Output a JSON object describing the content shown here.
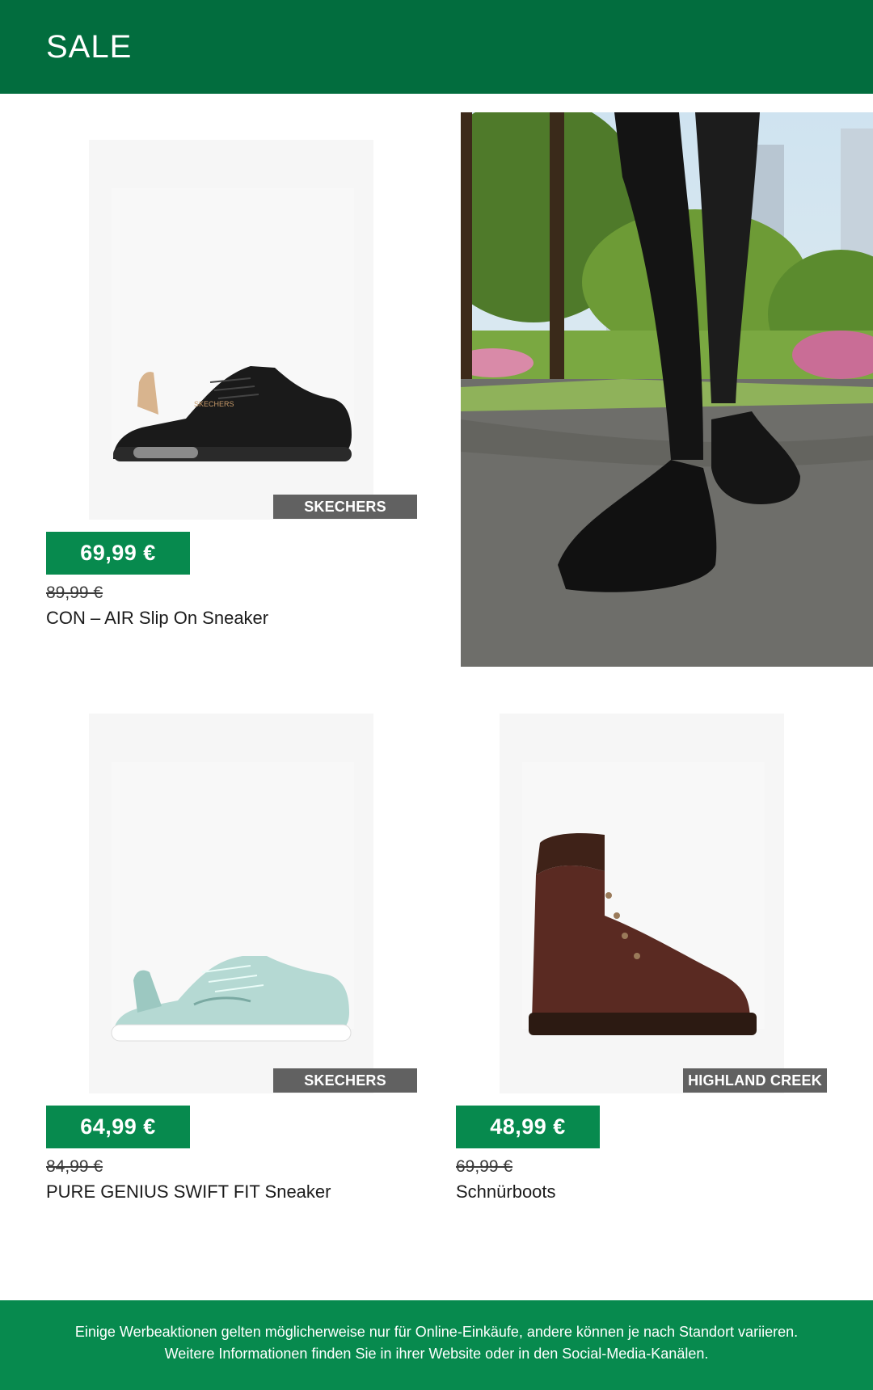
{
  "header": {
    "title": "SALE"
  },
  "products": [
    {
      "brand": "SKECHERS",
      "price": "69,99 €",
      "old_price": "89,99 €",
      "name": "CON – AIR Slip On Sneaker",
      "image": "black-sneaker"
    },
    {
      "brand": "SKECHERS",
      "price": "64,99 €",
      "old_price": "84,99 €",
      "name": "PURE GENIUS SWIFT FIT Sneaker",
      "image": "mint-sneaker"
    },
    {
      "brand": "HIGHLAND CREEK",
      "price": "48,99 €",
      "old_price": "69,99 €",
      "name": "Schnürboots",
      "image": "brown-boot"
    }
  ],
  "lifestyle_image": "person-walking-in-park-black-sneakers",
  "footer": {
    "text": "Einige Werbeaktionen gelten möglicherweise nur für Online-Einkäufe, andere können je nach Standort variieren. Weitere Informationen finden Sie in ihrer Website oder in den Social-Media-Kanälen."
  },
  "colors": {
    "header": "#026d3e",
    "price_badge": "#078a4e",
    "brand_tag": "#616161",
    "footer": "#078a4e"
  }
}
